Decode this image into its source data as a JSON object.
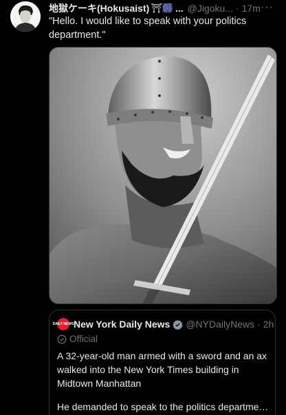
{
  "tweet": {
    "author_name": "地獄ケーキ(Hokusaist)",
    "author_emoji": "⛩🎆",
    "ellipsis": "...",
    "handle": "@Jigoku...",
    "separator": "·",
    "time": "17m",
    "more": "···",
    "text": "\"Hello. I would like to speak with your politics department.\"",
    "media_icon": "helmeted-warrior-photo"
  },
  "quote": {
    "logo_text": "DAILY NEWS",
    "author_name": "New York Daily News",
    "handle": "@NYDailyNews",
    "separator": "·",
    "time": "2h",
    "label": "Official",
    "text": "A 32-year-old man armed with a sword and an ax walked into the New York Times building in Midtown Manhattan",
    "text2": "He demanded to speak to the politics department...",
    "brand_color": "#e11d2e"
  }
}
